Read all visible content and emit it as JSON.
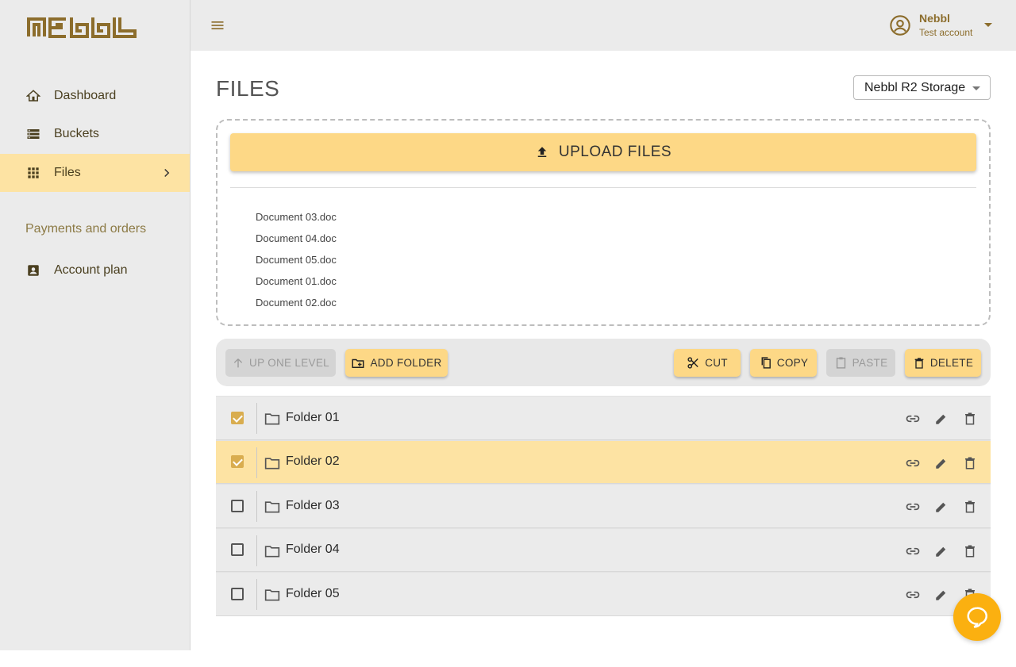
{
  "app": {
    "logo_text": "nebbl"
  },
  "sidebar": {
    "items": [
      {
        "label": "Dashboard",
        "icon": "home-icon"
      },
      {
        "label": "Buckets",
        "icon": "storage-icon"
      },
      {
        "label": "Files",
        "icon": "grid-icon",
        "active": true
      }
    ],
    "section_title": "Payments and orders",
    "section_items": [
      {
        "label": "Account plan",
        "icon": "account-box-icon"
      }
    ]
  },
  "header": {
    "user_name": "Nebbl",
    "user_sub": "Test account"
  },
  "main": {
    "title": "FILES",
    "storage_selected": "Nebbl R2 Storage",
    "upload_label": "UPLOAD FILES",
    "uploaded_files": [
      "Document 03.doc",
      "Document 04.doc",
      "Document 05.doc",
      "Document 01.doc",
      "Document 02.doc"
    ],
    "toolbar": {
      "up_one_level": "UP ONE LEVEL",
      "add_folder": "ADD FOLDER",
      "cut": "CUT",
      "copy": "COPY",
      "paste": "PASTE",
      "delete": "DELETE"
    },
    "folders": [
      {
        "name": "Folder 01",
        "checked": true,
        "highlighted": false
      },
      {
        "name": "Folder 02",
        "checked": true,
        "highlighted": true
      },
      {
        "name": "Folder 03",
        "checked": false,
        "highlighted": false
      },
      {
        "name": "Folder 04",
        "checked": false,
        "highlighted": false
      },
      {
        "name": "Folder 05",
        "checked": false,
        "highlighted": false
      }
    ]
  },
  "colors": {
    "accent": "#fdd886",
    "accent_light": "#fde3a3",
    "brand": "#8c6d2c",
    "checkbox": "#d9ad4f",
    "chat": "#fbb010"
  }
}
